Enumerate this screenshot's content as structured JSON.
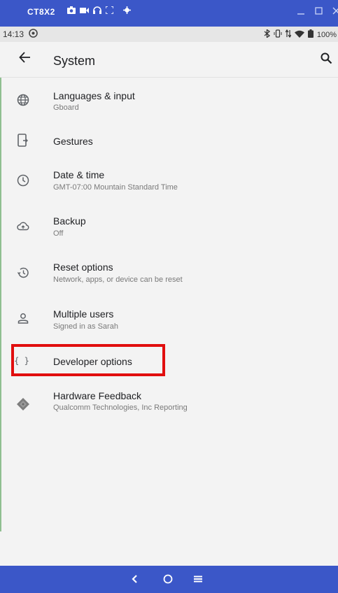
{
  "window": {
    "title": "CT8X2",
    "icons": [
      "camera-icon",
      "video-icon",
      "headset-icon",
      "fullscreen-icon",
      "settings-icon"
    ]
  },
  "status": {
    "time": "14:13",
    "battery": "100%"
  },
  "app_bar": {
    "title": "System"
  },
  "items": [
    {
      "title": "Languages & input",
      "subtitle": "Gboard",
      "icon": "globe-icon"
    },
    {
      "title": "Gestures",
      "subtitle": "",
      "icon": "gesture-phone-icon"
    },
    {
      "title": "Date & time",
      "subtitle": "GMT-07:00 Mountain Standard Time",
      "icon": "clock-icon"
    },
    {
      "title": "Backup",
      "subtitle": "Off",
      "icon": "cloud-upload-icon"
    },
    {
      "title": "Reset options",
      "subtitle": "Network, apps, or device can be reset",
      "icon": "history-icon"
    },
    {
      "title": "Multiple users",
      "subtitle": "Signed in as Sarah",
      "icon": "person-icon"
    },
    {
      "title": "Developer options",
      "subtitle": "",
      "icon": "braces-icon"
    },
    {
      "title": "Hardware Feedback",
      "subtitle": "Qualcomm Technologies, Inc Reporting",
      "icon": "chip-icon"
    }
  ],
  "braces_glyph": "{ }",
  "colors": {
    "window_bar": "#3b57c8",
    "highlight": "#e10e0e",
    "background": "#f3f3f3"
  }
}
